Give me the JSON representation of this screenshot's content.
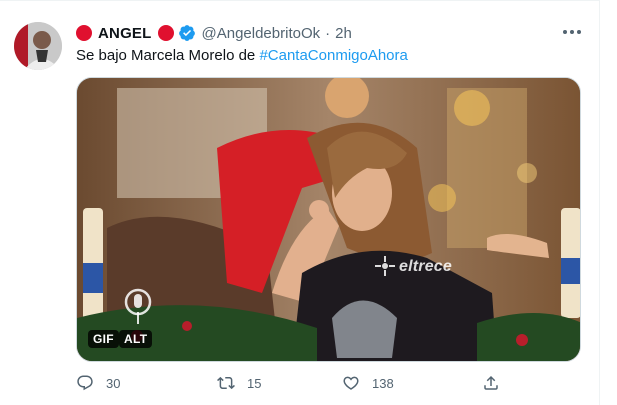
{
  "tweet": {
    "display_name": "ANGEL",
    "handle": "@AngeldebritoOk",
    "separator": "·",
    "time": "2h",
    "text_prefix": "Se bajo Marcela Morelo de ",
    "hashtag": "#CantaConmigoAhora",
    "verified": true
  },
  "media": {
    "badges": {
      "gif": "GIF",
      "alt": "ALT"
    },
    "watermark": "eltrece"
  },
  "actions": {
    "reply_count": "30",
    "retweet_count": "15",
    "like_count": "138"
  },
  "colors": {
    "accent": "#1d9bf0",
    "brand_dot": "#e0102f",
    "secondary_text": "#536471"
  },
  "icons": [
    "more-icon",
    "verified-badge-icon",
    "reply-icon",
    "retweet-icon",
    "like-icon",
    "share-icon",
    "eltrece-logo-icon"
  ]
}
